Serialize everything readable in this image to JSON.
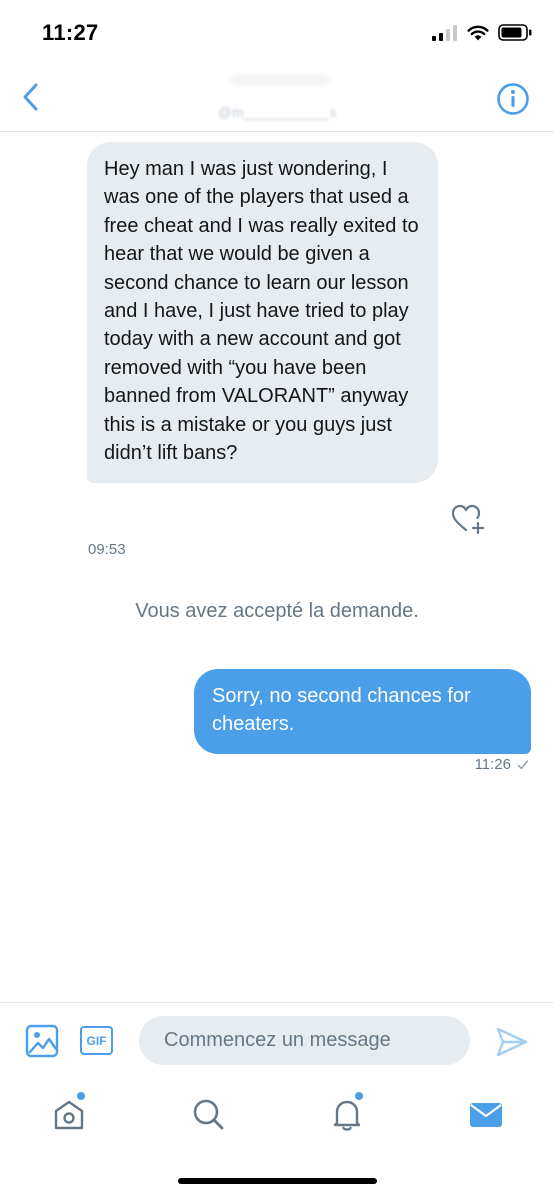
{
  "status_bar": {
    "time": "11:27"
  },
  "header": {
    "handle": "@m___________s"
  },
  "conversation": {
    "incoming": {
      "text": "Hey man I was just wondering, I was one of the players that used a free cheat and I was really exited to hear that we would be given a second chance to learn our lesson and I have, I just have tried to play today with a new account and got removed with “you have been banned from VALORANT” anyway this is a mistake or you guys just didn’t lift bans?",
      "time": "09:53"
    },
    "system_message": "Vous avez accepté la demande.",
    "outgoing": {
      "text": "Sorry, no second chances for cheaters.",
      "time": "11:26"
    }
  },
  "composer": {
    "gif_label": "GIF",
    "placeholder": "Commencez un message"
  },
  "tabbar": {
    "tabs": [
      "home-icon",
      "search-icon",
      "notifications-icon",
      "messages-icon"
    ]
  },
  "colors": {
    "accent": "#4a9fe8",
    "incoming_bubble": "#e6ecf0",
    "secondary_text": "#657786"
  }
}
